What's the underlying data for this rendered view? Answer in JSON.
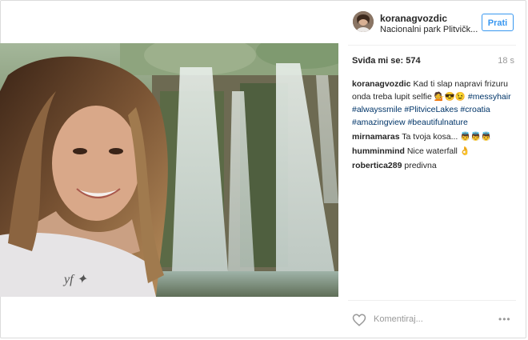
{
  "post": {
    "username": "koranagvozdic",
    "location": "Nacionalni park Plitvičk...",
    "follow_label": "Prati",
    "likes_text": "Sviđa mi se: 574",
    "timestamp": "18 s",
    "caption": {
      "username": "koranagvozdic",
      "text": "Kad ti slap napravi frizuru onda treba lupit selfie 💁😎😉",
      "hashtags": [
        "#messyhair",
        "#alwayssmile",
        "#PlitviceLakes",
        "#croatia",
        "#amazingview",
        "#beautifulnature"
      ]
    },
    "comments": [
      {
        "username": "mirnamaras",
        "text": "Ta tvoja kosa... 👼👼👼"
      },
      {
        "username": "humminmind",
        "text": "Nice waterfall 👌"
      },
      {
        "username": "robertica289",
        "text": "predivna"
      }
    ],
    "comment_placeholder": "Komentiraj...",
    "more_label": "•••"
  },
  "icons": {
    "like": "heart-icon",
    "more": "more-options-icon"
  },
  "colors": {
    "accent": "#3897f0",
    "hashtag": "#003569"
  }
}
